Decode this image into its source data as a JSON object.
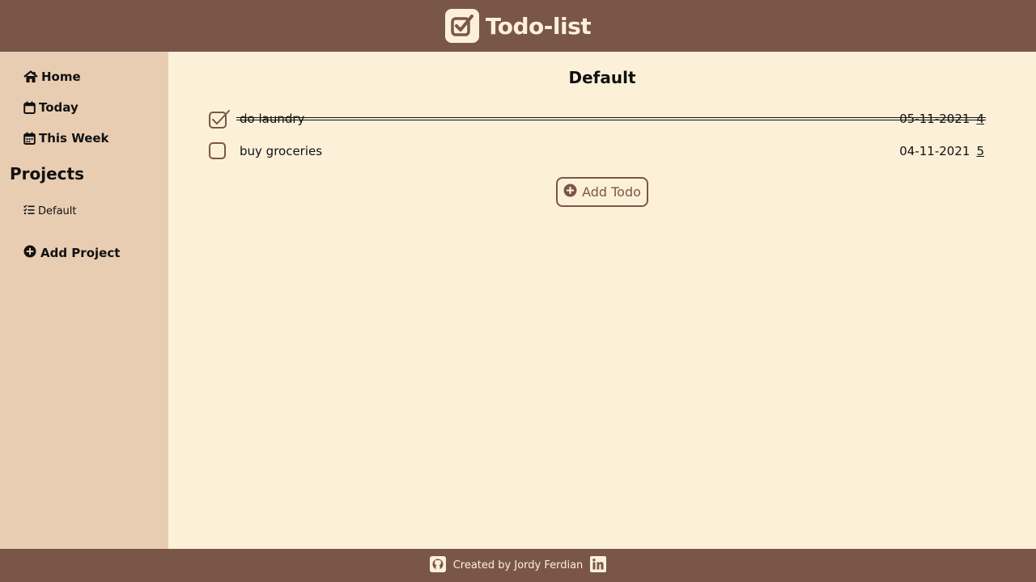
{
  "header": {
    "title": "Todo-list",
    "logo_icon": "checkbox-logo-icon"
  },
  "sidebar": {
    "nav": [
      {
        "label": "Home",
        "icon": "home-icon"
      },
      {
        "label": "Today",
        "icon": "calendar-day-icon"
      },
      {
        "label": "This Week",
        "icon": "calendar-week-icon"
      }
    ],
    "projects_heading": "Projects",
    "projects": [
      {
        "label": "Default",
        "icon": "tasks-icon"
      }
    ],
    "add_project_label": "Add Project"
  },
  "main": {
    "project_title": "Default",
    "todos": [
      {
        "title": "do laundry",
        "date": "05-11-2021",
        "priority": "4",
        "completed": true
      },
      {
        "title": "buy groceries",
        "date": "04-11-2021",
        "priority": "5",
        "completed": false
      }
    ],
    "add_todo_label": "Add Todo"
  },
  "footer": {
    "text": "Created by Jordy Ferdian",
    "github_icon": "github-icon",
    "linkedin_icon": "linkedin-icon"
  },
  "colors": {
    "brand": "#7a5648",
    "background": "#fcf1d8",
    "sidebar": "#e8cdb2",
    "text": "#111111"
  }
}
